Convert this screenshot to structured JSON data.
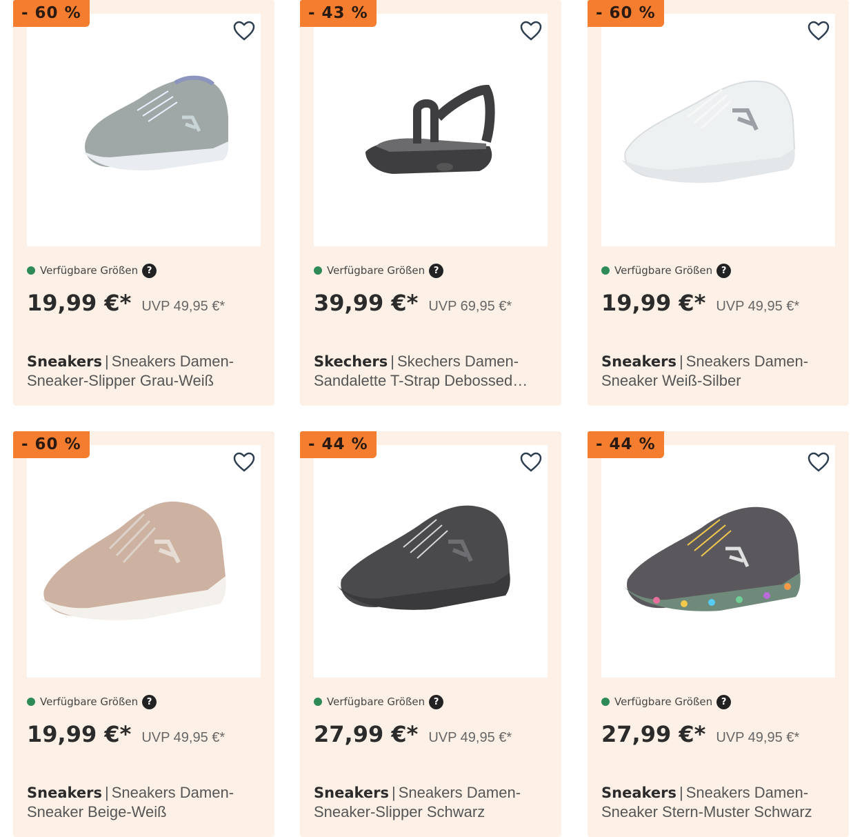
{
  "sizes_label": "Verfügbare Größen",
  "help_label": "?",
  "separator": "|",
  "colors": {
    "card_bg": "#fdf1e7",
    "badge_bg": "#f47d30",
    "available_dot": "#2e8b57"
  },
  "products": [
    {
      "discount": "- 60 %",
      "price": "19,99 €*",
      "uvp": "UVP 49,95 €*",
      "brand": "Sneakers",
      "name": "Sneakers Damen-Sneaker-Slipper Grau-Weiß",
      "shoe_color": "#9fa8a6"
    },
    {
      "discount": "- 43 %",
      "price": "39,99 €*",
      "uvp": "UVP 69,95 €*",
      "brand": "Skechers",
      "name": "Skechers Damen-Sandalette T-Strap Debossed Sandal Schwarz",
      "shoe_color": "#3e3e40"
    },
    {
      "discount": "- 60 %",
      "price": "19,99 €*",
      "uvp": "UVP 49,95 €*",
      "brand": "Sneakers",
      "name": "Sneakers Damen-Sneaker Weiß-Silber",
      "shoe_color": "#eef1f2"
    },
    {
      "discount": "- 60 %",
      "price": "19,99 €*",
      "uvp": "UVP 49,95 €*",
      "brand": "Sneakers",
      "name": "Sneakers Damen-Sneaker Beige-Weiß",
      "shoe_color": "#cdb2a1"
    },
    {
      "discount": "- 44 %",
      "price": "27,99 €*",
      "uvp": "UVP 49,95 €*",
      "brand": "Sneakers",
      "name": "Sneakers Damen-Sneaker-Slipper Schwarz",
      "shoe_color": "#4a4a4d"
    },
    {
      "discount": "- 44 %",
      "price": "27,99 €*",
      "uvp": "UVP 49,95 €*",
      "brand": "Sneakers",
      "name": "Sneakers Damen-Sneaker Stern-Muster Schwarz",
      "shoe_color": "#5a585d"
    }
  ]
}
